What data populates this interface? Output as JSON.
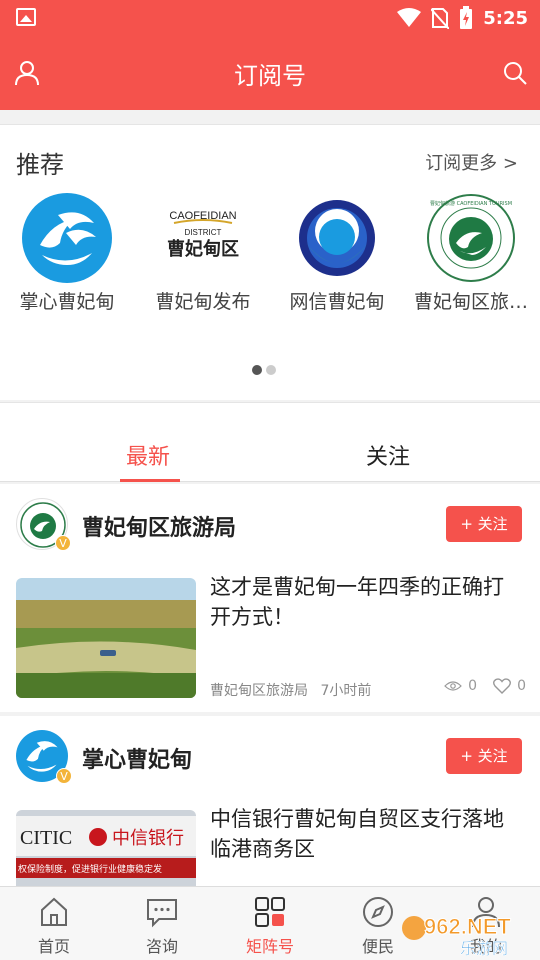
{
  "status_bar": {
    "time": "5:25"
  },
  "header": {
    "title": "订阅号"
  },
  "recommend": {
    "title": "推荐",
    "more_label": "订阅更多 >",
    "items": [
      {
        "name": "掌心曹妃甸"
      },
      {
        "name": "曹妃甸发布",
        "logo_text_top": "CAOFEIDIAN",
        "logo_text_mid": "DISTRICT",
        "logo_text_main": "曹妃甸区"
      },
      {
        "name": "网信曹妃甸"
      },
      {
        "name": "曹妃甸区旅…",
        "logo_text_ring": "曹妃甸旅游 CAOFEIDIAN TOURISM"
      }
    ]
  },
  "tabs": [
    {
      "label": "最新"
    },
    {
      "label": "关注"
    }
  ],
  "feed": [
    {
      "publisher": "曹妃甸区旅游局",
      "follow_label": "+ 关注",
      "title": "这才是曹妃甸一年四季的正确打开方式！",
      "source": "曹妃甸区旅游局",
      "time": "7小时前",
      "views": "0",
      "likes": "0"
    },
    {
      "publisher": "掌心曹妃甸",
      "follow_label": "+ 关注",
      "title": "中信银行曹妃甸自贸区支行落地临港商务区",
      "thumb_text_left": "CITIC",
      "thumb_text_right": "中信银行",
      "thumb_text_bottom": "权保险制度，促进银行业健康稳定发"
    }
  ],
  "bottom_nav": [
    {
      "label": "首页"
    },
    {
      "label": "咨询"
    },
    {
      "label": "矩阵号"
    },
    {
      "label": "便民"
    },
    {
      "label": "我的"
    }
  ],
  "watermark": {
    "text_big": "962.NET",
    "text_small": "乐游网"
  },
  "colors": {
    "brand": "#f5524c",
    "badge": "#f3b43a"
  }
}
